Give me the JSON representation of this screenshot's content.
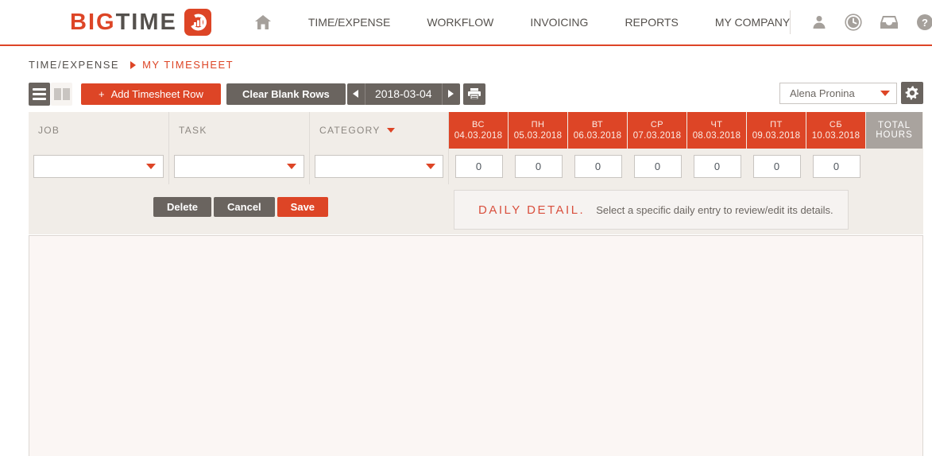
{
  "nav": {
    "logo_part1": "BIG",
    "logo_part2": "TIME",
    "items": [
      {
        "label": "TIME/EXPENSE"
      },
      {
        "label": "WORKFLOW"
      },
      {
        "label": "INVOICING"
      },
      {
        "label": "REPORTS"
      },
      {
        "label": "MY COMPANY"
      }
    ]
  },
  "breadcrumb": {
    "section": "TIME/EXPENSE",
    "page": "MY TIMESHEET"
  },
  "toolbar": {
    "add_row_plus": "+",
    "add_row_label": "Add Timesheet Row",
    "clear_blank_label": "Clear Blank Rows",
    "date": "2018-03-04",
    "staff_selected": "Alena Pronina"
  },
  "timesheet": {
    "headers": {
      "job": "JOB",
      "task": "TASK",
      "category": "CATEGORY",
      "total": "TOTAL HOURS"
    },
    "days": [
      {
        "dow": "ВС",
        "date": "04.03.2018"
      },
      {
        "dow": "ПН",
        "date": "05.03.2018"
      },
      {
        "dow": "ВТ",
        "date": "06.03.2018"
      },
      {
        "dow": "СР",
        "date": "07.03.2018"
      },
      {
        "dow": "ЧТ",
        "date": "08.03.2018"
      },
      {
        "dow": "ПТ",
        "date": "09.03.2018"
      },
      {
        "dow": "СБ",
        "date": "10.03.2018"
      }
    ],
    "row": {
      "job": "",
      "task": "",
      "category": "",
      "values": [
        "0",
        "0",
        "0",
        "0",
        "0",
        "0",
        "0"
      ]
    }
  },
  "actions": {
    "delete": "Delete",
    "cancel": "Cancel",
    "save": "Save"
  },
  "daily_detail": {
    "title": "DAILY DETAIL.",
    "message": "Select a specific daily entry to review/edit its details."
  },
  "colors": {
    "brand_red": "#DD4526",
    "button_gray": "#6A645F",
    "header_beige": "#F1EDE8",
    "total_gray": "#A9A39E",
    "panel_pink": "#FBF6F4"
  }
}
